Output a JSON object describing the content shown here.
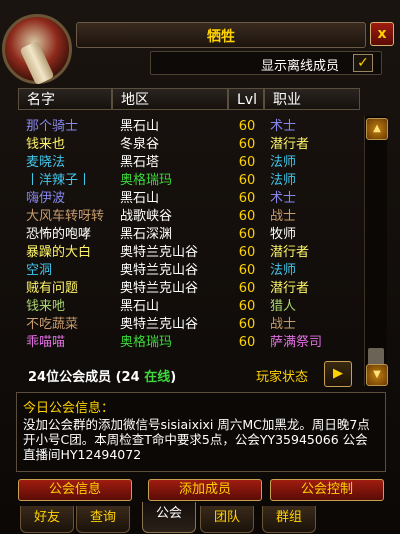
{
  "window": {
    "title": "牺牲",
    "close_label": "x"
  },
  "offline_toggle": {
    "label": "显示离线成员",
    "checked_mark": "✓"
  },
  "columns": {
    "name": "名字",
    "zone": "地区",
    "level": "Lvl",
    "class": "职业"
  },
  "class_colors": {
    "术士": "#8787ed",
    "潜行者": "#fff569",
    "法师": "#40c7eb",
    "战士": "#c79c6e",
    "牧师": "#ffffff",
    "猎人": "#abd473",
    "萨满祭司": "#e070e0"
  },
  "members": [
    {
      "name": "那个骑士",
      "zone": "黑石山",
      "level": "60",
      "class": "术士",
      "name_color": "#8787ed",
      "zone_color": "#ffffff"
    },
    {
      "name": "钱来也",
      "zone": "冬泉谷",
      "level": "60",
      "class": "潜行者",
      "name_color": "#fff569",
      "zone_color": "#ffffff"
    },
    {
      "name": "麦晓法",
      "zone": "黑石塔",
      "level": "60",
      "class": "法师",
      "name_color": "#40c7eb",
      "zone_color": "#ffffff"
    },
    {
      "name": "丨洋辣子丨",
      "zone": "奥格瑞玛",
      "level": "60",
      "class": "法师",
      "name_color": "#40c7eb",
      "zone_color": "#3cd83c"
    },
    {
      "name": "嗨伊波",
      "zone": "黑石山",
      "level": "60",
      "class": "术士",
      "name_color": "#8787ed",
      "zone_color": "#ffffff"
    },
    {
      "name": "大风车转呀转",
      "zone": "战歌峡谷",
      "level": "60",
      "class": "战士",
      "name_color": "#c79c6e",
      "zone_color": "#ffffff"
    },
    {
      "name": "恐怖的咆哮",
      "zone": "黑石深渊",
      "level": "60",
      "class": "牧师",
      "name_color": "#ffffff",
      "zone_color": "#ffffff"
    },
    {
      "name": "暴躁的大白",
      "zone": "奥特兰克山谷",
      "level": "60",
      "class": "潜行者",
      "name_color": "#fff569",
      "zone_color": "#ffffff"
    },
    {
      "name": "空洞",
      "zone": "奥特兰克山谷",
      "level": "60",
      "class": "法师",
      "name_color": "#40c7eb",
      "zone_color": "#ffffff"
    },
    {
      "name": "贼有问题",
      "zone": "奥特兰克山谷",
      "level": "60",
      "class": "潜行者",
      "name_color": "#fff569",
      "zone_color": "#ffffff"
    },
    {
      "name": "钱来吔",
      "zone": "黑石山",
      "level": "60",
      "class": "猎人",
      "name_color": "#abd473",
      "zone_color": "#ffffff"
    },
    {
      "name": "不吃蔬菜",
      "zone": "奥特兰克山谷",
      "level": "60",
      "class": "战士",
      "name_color": "#c79c6e",
      "zone_color": "#ffffff"
    },
    {
      "name": "乖喵喵",
      "zone": "奥格瑞玛",
      "level": "60",
      "class": "萨满祭司",
      "name_color": "#e070e0",
      "zone_color": "#3cd83c"
    }
  ],
  "summary": {
    "count_text": "24位公会成员 (24 ",
    "online_text": "在线",
    "close_paren": ")"
  },
  "player_status": {
    "label": "玩家状态",
    "arrow": "▶"
  },
  "motd": {
    "title": "今日公会信息：",
    "text": "没加公会群的添加微信号sisiaixixi 周六MC加黑龙。周日晚7点开小号C团。本周检查T命中要求5点，公会YY35945066 公会直播间HY12494072"
  },
  "buttons": {
    "info": "公会信息",
    "add": "添加成员",
    "control": "公会控制"
  },
  "tabs": [
    {
      "label": "好友",
      "active": false
    },
    {
      "label": "查询",
      "active": false
    },
    {
      "label": "公会",
      "active": true
    },
    {
      "label": "团队",
      "active": false
    },
    {
      "label": "群组",
      "active": false
    }
  ]
}
